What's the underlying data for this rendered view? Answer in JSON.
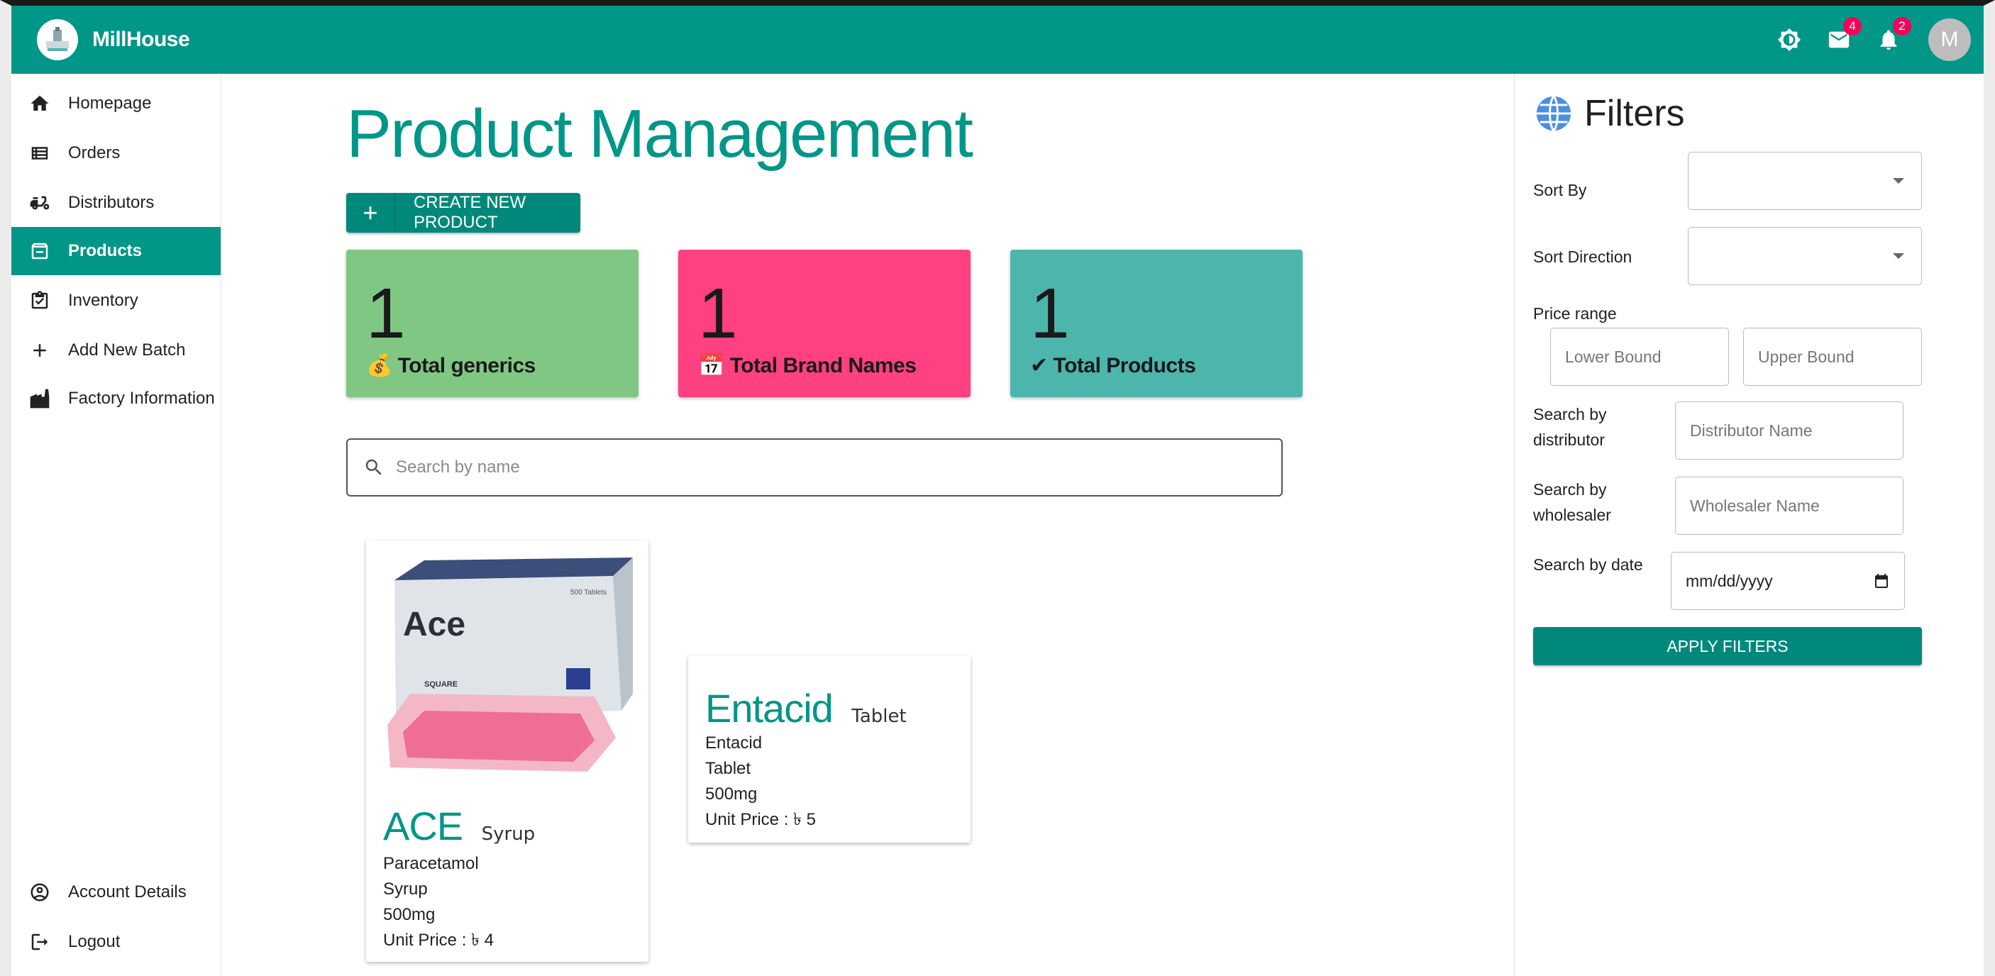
{
  "app": {
    "brand": "MillHouse",
    "avatar_initial": "M",
    "mail_count": "4",
    "notification_count": "2"
  },
  "sidebar": {
    "items": [
      {
        "label": "Homepage",
        "icon": "home-icon"
      },
      {
        "label": "Orders",
        "icon": "list-icon"
      },
      {
        "label": "Distributors",
        "icon": "scooter-icon"
      },
      {
        "label": "Products",
        "icon": "archive-icon",
        "active": true
      },
      {
        "label": "Inventory",
        "icon": "clipboard-icon"
      },
      {
        "label": "Add New Batch",
        "icon": "plus-icon"
      },
      {
        "label": "Factory Information",
        "icon": "factory-icon"
      }
    ],
    "bottom": [
      {
        "label": "Account Details",
        "icon": "account-circle-icon"
      },
      {
        "label": "Logout",
        "icon": "logout-icon"
      }
    ]
  },
  "main": {
    "title": "Product Management",
    "create_label": "CREATE NEW PRODUCT",
    "stats": [
      {
        "value": "1",
        "emoji": "💰",
        "label": "Total generics",
        "color": "#81c784"
      },
      {
        "value": "1",
        "emoji": "📅",
        "label": "Total Brand Names",
        "color": "#ff4081"
      },
      {
        "value": "1",
        "emoji": "✔",
        "label": "Total Products",
        "color": "#4db6ac"
      }
    ],
    "search_placeholder": "Search by name",
    "products": [
      {
        "name": "ACE",
        "type": "Syrup",
        "generic": "Paracetamol",
        "form": "Syrup",
        "strength": "500mg",
        "price": "Unit Price : ৳ 4",
        "image_brand": "Ace",
        "image_count": "500 Tablets",
        "image_maker": "SQUARE"
      },
      {
        "name": "Entacid",
        "type": "Tablet",
        "generic": "Entacid",
        "form": "Tablet",
        "strength": "500mg",
        "price": "Unit Price : ৳ 5"
      }
    ]
  },
  "filters": {
    "title": "Filters",
    "sort_by_label": "Sort By",
    "sort_direction_label": "Sort Direction",
    "price_range_label": "Price range",
    "lower_placeholder": "Lower Bound",
    "upper_placeholder": "Upper Bound",
    "distributor_label": "Search by distributor",
    "distributor_placeholder": "Distributor Name",
    "wholesaler_label": "Search by wholesaler",
    "wholesaler_placeholder": "Wholesaler Name",
    "date_label": "Search by date",
    "date_placeholder": "mm/dd/yyyy",
    "apply_label": "APPLY FILTERS"
  }
}
